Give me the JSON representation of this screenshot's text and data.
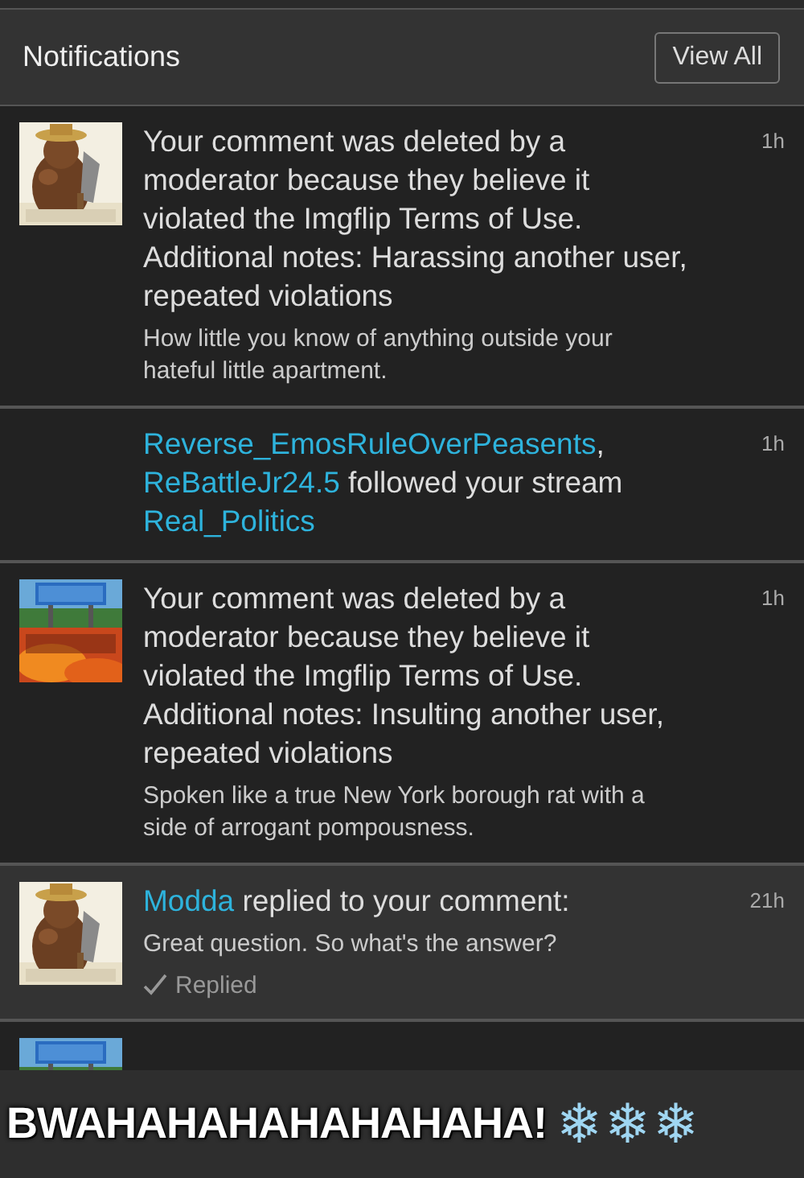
{
  "header": {
    "title": "Notifications",
    "button": "View All"
  },
  "notifications": [
    {
      "thumbnail": true,
      "highlighted": false,
      "time": "1h",
      "message": [
        {
          "text": "Your comment was deleted by a moderator because they believe it violated the Imgflip Terms of Use. Additional notes: Harassing another user, repeated violations",
          "link": false
        }
      ],
      "comment": "How little you know of anything outside your hateful little apartment."
    },
    {
      "highlighted": false,
      "time": "1h",
      "message": [
        {
          "text": "Reverse_EmosRuleOverPeasents",
          "link": true
        },
        {
          "text": ", ",
          "link": false
        },
        {
          "text": "ReBattleJr24.5",
          "link": true
        },
        {
          "text": " followed your stream ",
          "link": false
        },
        {
          "text": "Real_Politics",
          "link": true
        }
      ]
    },
    {
      "thumbnail": true,
      "highlighted": false,
      "time": "1h",
      "message": [
        {
          "text": "Your comment was deleted by a moderator because they believe it violated the Imgflip Terms of Use. Additional notes: Insulting another user, repeated violations",
          "link": false
        }
      ],
      "comment": "Spoken like a true New York borough rat with a side of arrogant pompousness."
    },
    {
      "thumbnail": true,
      "highlighted": true,
      "time": "21h",
      "message": [
        {
          "text": "Modda",
          "link": true
        },
        {
          "text": " replied to your comment:",
          "link": false
        }
      ],
      "comment": "Great question. So what's the answer?",
      "status": "Replied"
    },
    {
      "thumbnail": true,
      "highlighted": false
    }
  ],
  "caption": {
    "text": "BWAHAHAHAHAHAHAHA!",
    "emoji": "❄❄❄"
  }
}
